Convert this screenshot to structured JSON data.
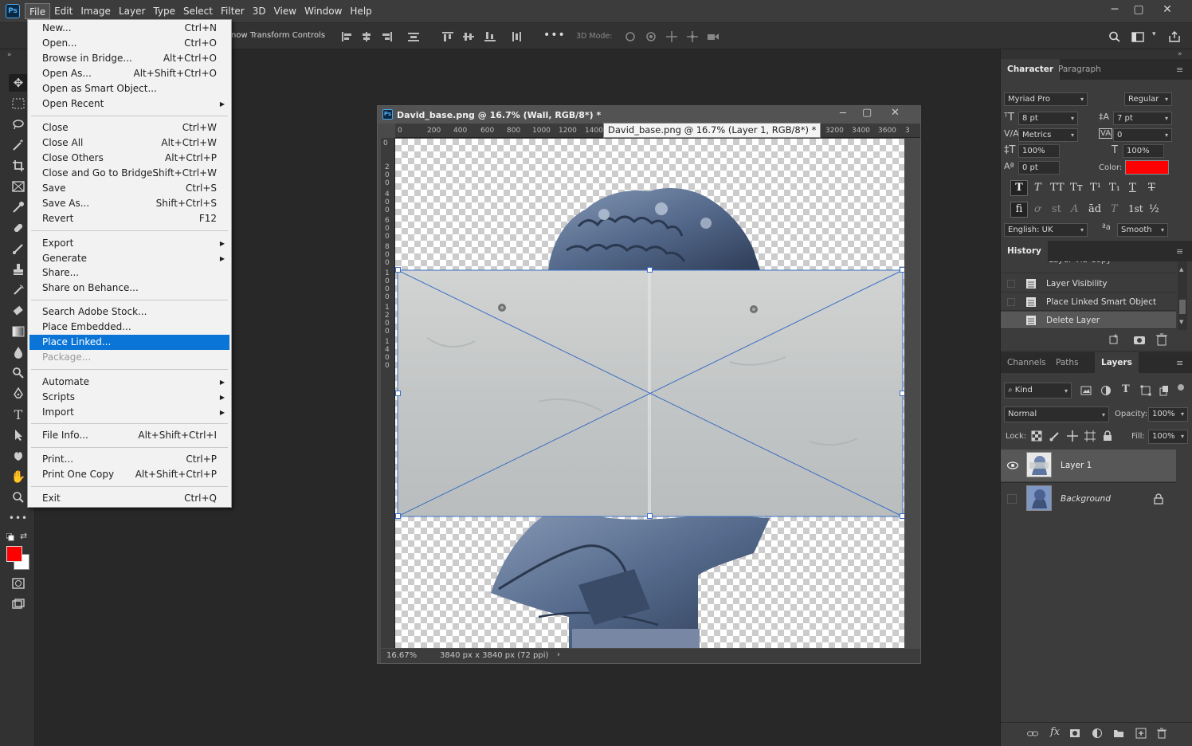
{
  "app": {
    "logo": "Ps"
  },
  "menubar": {
    "items": [
      "File",
      "Edit",
      "Image",
      "Layer",
      "Type",
      "Select",
      "Filter",
      "3D",
      "View",
      "Window",
      "Help"
    ],
    "controls": {
      "minimize": "─",
      "restore": "▢",
      "close": "✕"
    }
  },
  "options_bar": {
    "show_transform_text": "now Transform Controls",
    "mode_3d": "3D Mode:"
  },
  "file_menu": {
    "items": [
      {
        "label": "New...",
        "shortcut": "Ctrl+N"
      },
      {
        "label": "Open...",
        "shortcut": "Ctrl+O"
      },
      {
        "label": "Browse in Bridge...",
        "shortcut": "Alt+Ctrl+O"
      },
      {
        "label": "Open As...",
        "shortcut": "Alt+Shift+Ctrl+O"
      },
      {
        "label": "Open as Smart Object...",
        "shortcut": ""
      },
      {
        "label": "Open Recent",
        "shortcut": "",
        "submenu": true
      },
      {
        "label": "Close",
        "shortcut": "Ctrl+W"
      },
      {
        "label": "Close All",
        "shortcut": "Alt+Ctrl+W"
      },
      {
        "label": "Close Others",
        "shortcut": "Alt+Ctrl+P"
      },
      {
        "label": "Close and Go to Bridge...",
        "shortcut": "Shift+Ctrl+W"
      },
      {
        "label": "Save",
        "shortcut": "Ctrl+S"
      },
      {
        "label": "Save As...",
        "shortcut": "Shift+Ctrl+S"
      },
      {
        "label": "Revert",
        "shortcut": "F12"
      },
      {
        "label": "Export",
        "shortcut": "",
        "submenu": true
      },
      {
        "label": "Generate",
        "shortcut": "",
        "submenu": true
      },
      {
        "label": "Share...",
        "shortcut": ""
      },
      {
        "label": "Share on Behance...",
        "shortcut": ""
      },
      {
        "label": "Search Adobe Stock...",
        "shortcut": ""
      },
      {
        "label": "Place Embedded...",
        "shortcut": ""
      },
      {
        "label": "Place Linked...",
        "shortcut": "",
        "highlighted": true
      },
      {
        "label": "Package...",
        "shortcut": "",
        "disabled": true
      },
      {
        "label": "Automate",
        "shortcut": "",
        "submenu": true
      },
      {
        "label": "Scripts",
        "shortcut": "",
        "submenu": true
      },
      {
        "label": "Import",
        "shortcut": "",
        "submenu": true
      },
      {
        "label": "File Info...",
        "shortcut": "Alt+Shift+Ctrl+I"
      },
      {
        "label": "Print...",
        "shortcut": "Ctrl+P"
      },
      {
        "label": "Print One Copy",
        "shortcut": "Alt+Shift+Ctrl+P"
      },
      {
        "label": "Exit",
        "shortcut": "Ctrl+Q"
      }
    ]
  },
  "document": {
    "title": "David_base.png @ 16.7% (Wall, RGB/8*) *",
    "tooltip": "David_base.png @ 16.7% (Layer 1, RGB/8*) *",
    "zoom": "16.67%",
    "dimensions": "3840 px x 3840 px (72 ppi)",
    "hruler": [
      "0",
      "200",
      "400",
      "600",
      "800",
      "1000",
      "1200",
      "1400",
      "3200",
      "3400",
      "3600",
      "3"
    ],
    "vruler": [
      "0",
      "2",
      "0",
      "0",
      "4",
      "0",
      "0",
      "6",
      "0",
      "0",
      "8",
      "0",
      "0",
      "1",
      "0",
      "0",
      "0",
      "1",
      "2",
      "0",
      "0",
      "1",
      "4",
      "0",
      "0"
    ]
  },
  "character": {
    "tab_character": "Character",
    "tab_paragraph": "Paragraph",
    "font_family": "Myriad Pro",
    "font_style": "Regular",
    "font_size": "8 pt",
    "leading": "7 pt",
    "kerning": "Metrics",
    "tracking": "0",
    "vscale": "100%",
    "hscale": "100%",
    "baseline": "0 pt",
    "color_label": "Color:",
    "color": "#ff0000",
    "language": "English: UK",
    "aa_label": "ªa",
    "antialias": "Smooth",
    "type_buttons": [
      "T",
      "T",
      "TT",
      "Tт",
      "T¹",
      "T₁",
      "T",
      "T"
    ],
    "ot_buttons": [
      "fi",
      "ơ",
      "st",
      "A",
      "ād",
      "T",
      "1st",
      "½"
    ]
  },
  "history": {
    "title": "History",
    "items": [
      "Layer Visibility",
      "Place Linked Smart Object",
      "Delete Layer"
    ]
  },
  "layers": {
    "tab_channels": "Channels",
    "tab_paths": "Paths",
    "tab_layers": "Layers",
    "filter_kind": "Kind",
    "blend_mode": "Normal",
    "opacity_label": "Opacity:",
    "opacity": "100%",
    "lock_label": "Lock:",
    "fill_label": "Fill:",
    "fill": "100%",
    "items": [
      {
        "name": "Layer 1",
        "visible": true,
        "locked": false
      },
      {
        "name": "Background",
        "visible": false,
        "locked": true
      }
    ]
  },
  "colors": {
    "accent": "#0a75d6",
    "foreground": "#ff0000",
    "background": "#ffffff"
  }
}
